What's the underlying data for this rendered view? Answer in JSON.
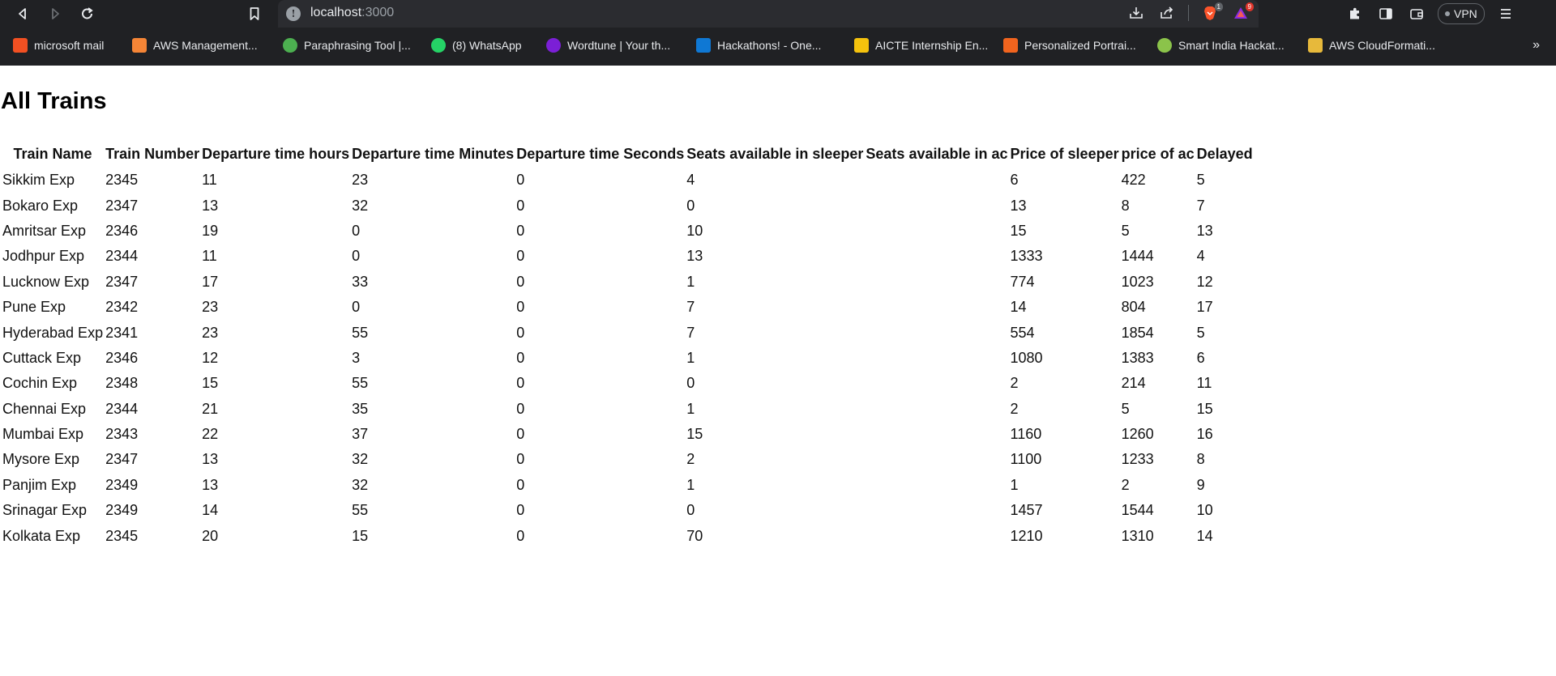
{
  "browser": {
    "url_host": "localhost",
    "url_port": ":3000",
    "brave_badge": "1",
    "rewards_badge": "9",
    "vpn_label": "VPN",
    "bookmarks": [
      {
        "label": "microsoft mail",
        "icon": "microsoft-icon",
        "color": "#f25022"
      },
      {
        "label": "AWS Management...",
        "icon": "aws-icon",
        "color": "#f58536"
      },
      {
        "label": "Paraphrasing Tool |...",
        "icon": "quillbot-icon",
        "color": "#4caf50"
      },
      {
        "label": "(8) WhatsApp",
        "icon": "whatsapp-icon",
        "color": "#25d366"
      },
      {
        "label": "Wordtune | Your th...",
        "icon": "wordtune-icon",
        "color": "#7b1fd6"
      },
      {
        "label": "Hackathons! - One...",
        "icon": "onedrive-icon",
        "color": "#0f78d4"
      },
      {
        "label": "AICTE Internship En...",
        "icon": "aicte-icon",
        "color": "#f4c20d"
      },
      {
        "label": "Personalized Portrai...",
        "icon": "etsy-icon",
        "color": "#f1641e"
      },
      {
        "label": "Smart India Hackat...",
        "icon": "sih-icon",
        "color": "#8bc34a"
      },
      {
        "label": "AWS CloudFormati...",
        "icon": "aws-cloudformation-icon",
        "color": "#e7b93b"
      }
    ],
    "more_label": "»"
  },
  "page": {
    "title": "All Trains",
    "columns": [
      "Train Name",
      "Train Number",
      "Departure time hours",
      "Departure time Minutes",
      "Departure time Seconds",
      "Seats available in sleeper",
      "Seats available in ac",
      "Price of sleeper",
      "price of ac",
      "Delayed"
    ],
    "rows": [
      [
        "Sikkim Exp",
        "2345",
        "11",
        "23",
        "0",
        "4",
        "",
        "6",
        "422",
        "5"
      ],
      [
        "Bokaro Exp",
        "2347",
        "13",
        "32",
        "0",
        "0",
        "",
        "13",
        "8",
        "7"
      ],
      [
        "Amritsar Exp",
        "2346",
        "19",
        "0",
        "0",
        "10",
        "",
        "15",
        "5",
        "13"
      ],
      [
        "Jodhpur Exp",
        "2344",
        "11",
        "0",
        "0",
        "13",
        "",
        "1333",
        "1444",
        "4"
      ],
      [
        "Lucknow Exp",
        "2347",
        "17",
        "33",
        "0",
        "1",
        "",
        "774",
        "1023",
        "12"
      ],
      [
        "Pune Exp",
        "2342",
        "23",
        "0",
        "0",
        "7",
        "",
        "14",
        "804",
        "17"
      ],
      [
        "Hyderabad Exp",
        "2341",
        "23",
        "55",
        "0",
        "7",
        "",
        "554",
        "1854",
        "5"
      ],
      [
        "Cuttack Exp",
        "2346",
        "12",
        "3",
        "0",
        "1",
        "",
        "1080",
        "1383",
        "6"
      ],
      [
        "Cochin Exp",
        "2348",
        "15",
        "55",
        "0",
        "0",
        "",
        "2",
        "214",
        "11"
      ],
      [
        "Chennai Exp",
        "2344",
        "21",
        "35",
        "0",
        "1",
        "",
        "2",
        "5",
        "15"
      ],
      [
        "Mumbai Exp",
        "2343",
        "22",
        "37",
        "0",
        "15",
        "",
        "1160",
        "1260",
        "16"
      ],
      [
        "Mysore Exp",
        "2347",
        "13",
        "32",
        "0",
        "2",
        "",
        "1100",
        "1233",
        "8"
      ],
      [
        "Panjim Exp",
        "2349",
        "13",
        "32",
        "0",
        "1",
        "",
        "1",
        "2",
        "9"
      ],
      [
        "Srinagar Exp",
        "2349",
        "14",
        "55",
        "0",
        "0",
        "",
        "1457",
        "1544",
        "10"
      ],
      [
        "Kolkata Exp",
        "2345",
        "20",
        "15",
        "0",
        "70",
        "",
        "1210",
        "1310",
        "14"
      ]
    ]
  }
}
